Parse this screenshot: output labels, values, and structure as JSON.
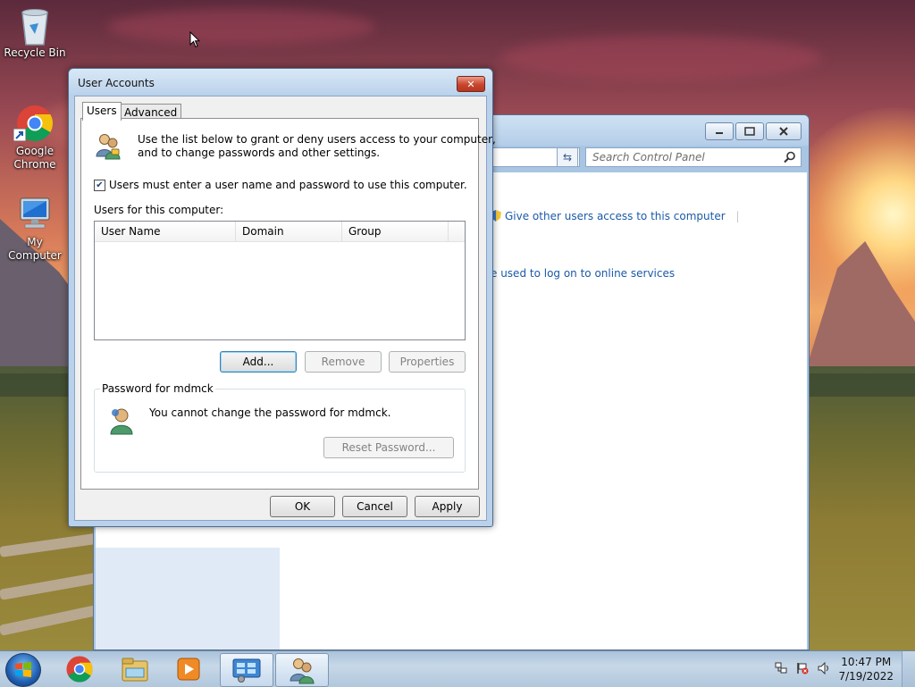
{
  "desktop": {
    "icons": [
      {
        "label": "Recycle Bin",
        "icon": "recycle-bin-icon"
      },
      {
        "label": "Google Chrome",
        "label_lines": [
          "Google",
          "Chrome"
        ],
        "icon": "chrome-icon"
      },
      {
        "label": "My Computer",
        "icon": "computer-icon"
      }
    ]
  },
  "control_panel": {
    "search_placeholder": "Search Control Panel",
    "links": [
      "Give other users access to this computer",
      "e used to log on to online services"
    ]
  },
  "dialog": {
    "title": "User Accounts",
    "tabs": [
      {
        "label": "Users",
        "active": true
      },
      {
        "label": "Advanced",
        "active": false
      }
    ],
    "intro_lines": [
      "Use the list below to grant or deny users access to your computer,",
      "and to change passwords and other settings."
    ],
    "require_login_checkbox": {
      "label": "Users must enter a user name and password to use this computer.",
      "checked": true
    },
    "users_label": "Users for this computer:",
    "columns": [
      "User Name",
      "Domain",
      "Group"
    ],
    "rows": [],
    "buttons": {
      "add": "Add...",
      "remove": "Remove",
      "properties": "Properties"
    },
    "password_group": {
      "title": "Password for mdmck",
      "message": "You cannot change the password for mdmck.",
      "reset_button": "Reset Password..."
    },
    "footer": {
      "ok": "OK",
      "cancel": "Cancel",
      "apply": "Apply"
    }
  },
  "taskbar": {
    "items": [
      "chrome-icon",
      "windows-explorer-icon",
      "media-player-icon",
      "control-panel-icon",
      "user-accounts-icon"
    ],
    "clock": {
      "time": "10:47 PM",
      "date": "7/19/2022"
    }
  }
}
